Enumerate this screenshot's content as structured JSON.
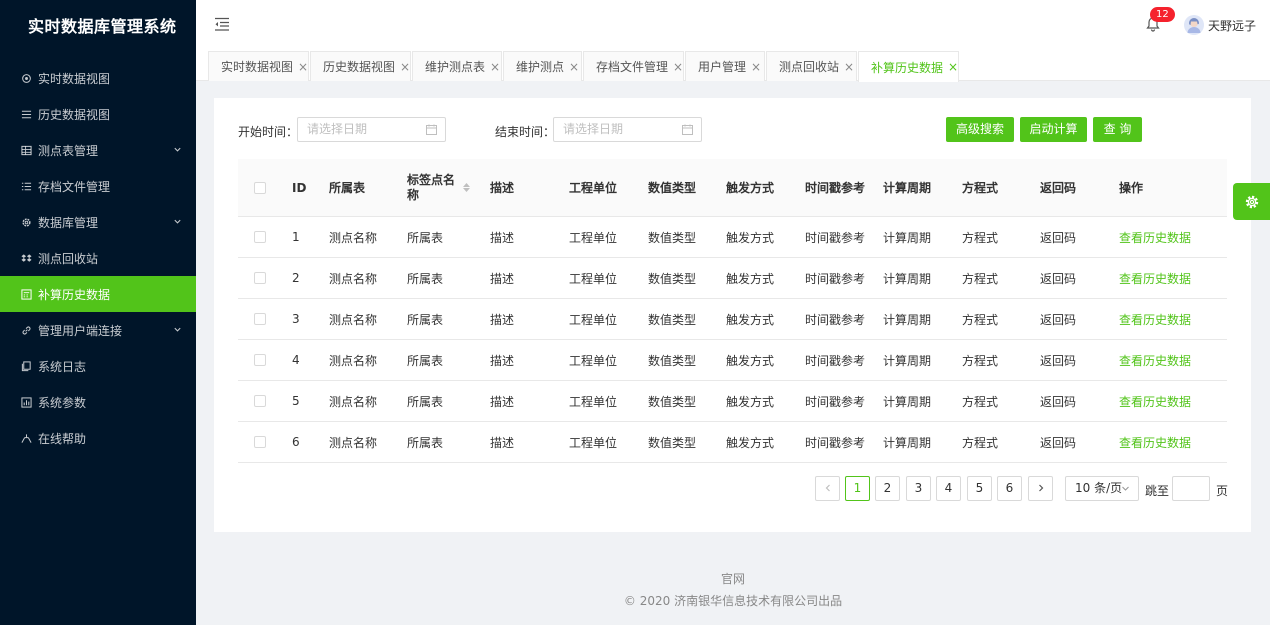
{
  "app": {
    "title": "实时数据库管理系统"
  },
  "sidebar": {
    "items": [
      {
        "label": "实时数据视图",
        "icon": "eye-icon"
      },
      {
        "label": "历史数据视图",
        "icon": "list-icon"
      },
      {
        "label": "测点表管理",
        "icon": "table-icon",
        "has_submenu": true
      },
      {
        "label": "存档文件管理",
        "icon": "bars-icon"
      },
      {
        "label": "数据库管理",
        "icon": "gear-icon",
        "has_submenu": true
      },
      {
        "label": "测点回收站",
        "icon": "dropbox-icon"
      },
      {
        "label": "补算历史数据",
        "icon": "calculator-icon",
        "active": true
      },
      {
        "label": "管理用户端连接",
        "icon": "link-icon",
        "has_submenu": true
      },
      {
        "label": "系统日志",
        "icon": "copy-icon"
      },
      {
        "label": "系统参数",
        "icon": "chart-icon"
      },
      {
        "label": "在线帮助",
        "icon": "help-icon"
      }
    ]
  },
  "header": {
    "notification_count": "12",
    "username": "天野远子"
  },
  "tabs": [
    {
      "label": "实时数据视图"
    },
    {
      "label": "历史数据视图"
    },
    {
      "label": "维护测点表"
    },
    {
      "label": "维护测点"
    },
    {
      "label": "存档文件管理"
    },
    {
      "label": "用户管理"
    },
    {
      "label": "测点回收站"
    },
    {
      "label": "补算历史数据",
      "active": true
    }
  ],
  "tab_close_glyph": "×",
  "filters": {
    "start_label": "开始时间：",
    "start_placeholder": "请选择日期",
    "end_label": "结束时间：",
    "end_placeholder": "请选择日期"
  },
  "buttons": {
    "advanced_search": "高级搜索",
    "start_calc": "启动计算",
    "query": "查 询"
  },
  "table": {
    "columns": [
      "ID",
      "所属表",
      "标签点名称",
      "描述",
      "工程单位",
      "数值类型",
      "触发方式",
      "时间戳参考",
      "计算周期",
      "方程式",
      "返回码",
      "操作"
    ],
    "rows": [
      {
        "id": "1",
        "c1": "测点名称",
        "c2": "所属表",
        "c3": "描述",
        "c4": "工程单位",
        "c5": "数值类型",
        "c6": "触发方式",
        "c7": "时间戳参考",
        "c8": "计算周期",
        "c9": "方程式",
        "c10": "返回码",
        "action": "查看历史数据"
      },
      {
        "id": "2",
        "c1": "测点名称",
        "c2": "所属表",
        "c3": "描述",
        "c4": "工程单位",
        "c5": "数值类型",
        "c6": "触发方式",
        "c7": "时间戳参考",
        "c8": "计算周期",
        "c9": "方程式",
        "c10": "返回码",
        "action": "查看历史数据"
      },
      {
        "id": "3",
        "c1": "测点名称",
        "c2": "所属表",
        "c3": "描述",
        "c4": "工程单位",
        "c5": "数值类型",
        "c6": "触发方式",
        "c7": "时间戳参考",
        "c8": "计算周期",
        "c9": "方程式",
        "c10": "返回码",
        "action": "查看历史数据"
      },
      {
        "id": "4",
        "c1": "测点名称",
        "c2": "所属表",
        "c3": "描述",
        "c4": "工程单位",
        "c5": "数值类型",
        "c6": "触发方式",
        "c7": "时间戳参考",
        "c8": "计算周期",
        "c9": "方程式",
        "c10": "返回码",
        "action": "查看历史数据"
      },
      {
        "id": "5",
        "c1": "测点名称",
        "c2": "所属表",
        "c3": "描述",
        "c4": "工程单位",
        "c5": "数值类型",
        "c6": "触发方式",
        "c7": "时间戳参考",
        "c8": "计算周期",
        "c9": "方程式",
        "c10": "返回码",
        "action": "查看历史数据"
      },
      {
        "id": "6",
        "c1": "测点名称",
        "c2": "所属表",
        "c3": "描述",
        "c4": "工程单位",
        "c5": "数值类型",
        "c6": "触发方式",
        "c7": "时间戳参考",
        "c8": "计算周期",
        "c9": "方程式",
        "c10": "返回码",
        "action": "查看历史数据"
      }
    ]
  },
  "pagination": {
    "pages": [
      "1",
      "2",
      "3",
      "4",
      "5",
      "6"
    ],
    "current": "1",
    "page_size": "10 条/页",
    "jump_label": "跳至",
    "page_suffix": "页"
  },
  "footer": {
    "link": "官网",
    "copyright": "© 2020 济南银华信息技术有限公司出品"
  },
  "colors": {
    "accent": "#52c41a",
    "sidebar_bg": "#001529",
    "badge": "#f5222d"
  }
}
